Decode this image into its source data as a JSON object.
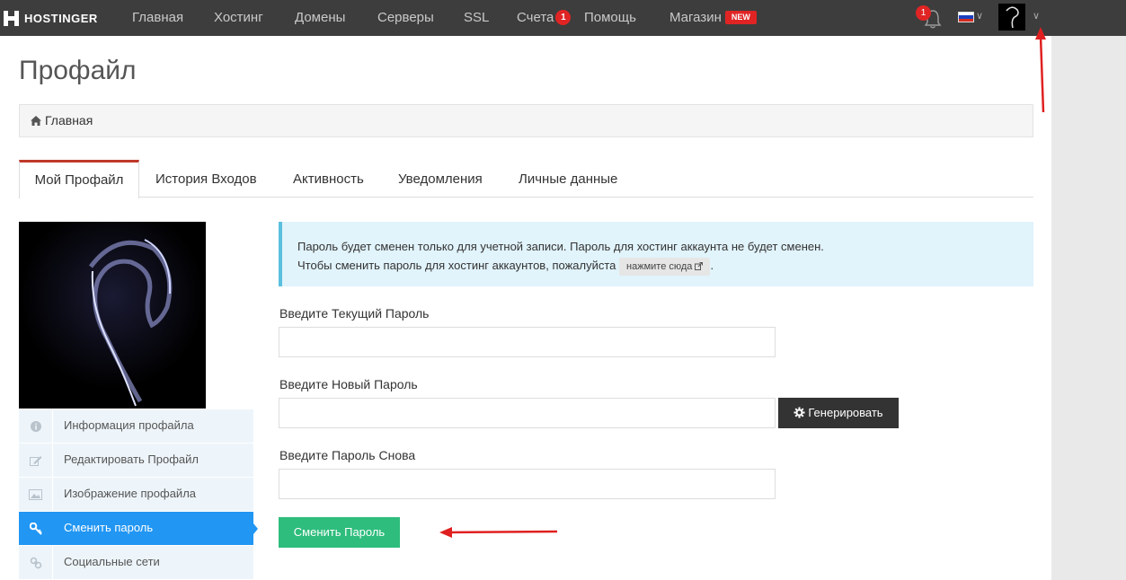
{
  "nav": {
    "brand": "HOSTINGER",
    "items": [
      {
        "label": "Главная"
      },
      {
        "label": "Хостинг"
      },
      {
        "label": "Домены"
      },
      {
        "label": "Серверы"
      },
      {
        "label": "SSL"
      },
      {
        "label": "Счета",
        "badge": "1"
      },
      {
        "label": "Помощь"
      },
      {
        "label": "Магазин",
        "tag": "NEW"
      }
    ],
    "notifications_count": "1",
    "language": "ru"
  },
  "page": {
    "title": "Профайл",
    "breadcrumb": "Главная"
  },
  "tabs": [
    {
      "label": "Мой Профайл",
      "active": true
    },
    {
      "label": "История Входов"
    },
    {
      "label": "Активность"
    },
    {
      "label": "Уведомления"
    },
    {
      "label": "Личные данные"
    }
  ],
  "side_menu": [
    {
      "label": "Информация профайла",
      "icon": "info-icon"
    },
    {
      "label": "Редактировать Профайл",
      "icon": "edit-icon"
    },
    {
      "label": "Изображение профайла",
      "icon": "image-icon"
    },
    {
      "label": "Сменить пароль",
      "icon": "key-icon",
      "active": true
    },
    {
      "label": "Социальные сети",
      "icon": "link-icon"
    }
  ],
  "alert": {
    "line1": "Пароль будет сменен только для учетной записи. Пароль для хостинг аккаунта не будет сменен.",
    "line2": "Чтобы сменить пароль для хостинг аккаунтов, пожалуйста",
    "button": "нажмите сюда",
    "end": "."
  },
  "form": {
    "current_label": "Введите Текущий Пароль",
    "current_value": "",
    "new_label": "Введите Новый Пароль",
    "new_value": "",
    "repeat_label": "Введите Пароль Снова",
    "repeat_value": "",
    "generate_button": "Генерировать",
    "submit_button": "Сменить Пароль"
  },
  "colors": {
    "topbar": "#3d3d3d",
    "accent_tab": "#c0392b",
    "active_menu": "#2196f3",
    "submit": "#2ebd7d",
    "alert_bg": "#e1f3fb",
    "annotation_arrow": "#e02020"
  }
}
